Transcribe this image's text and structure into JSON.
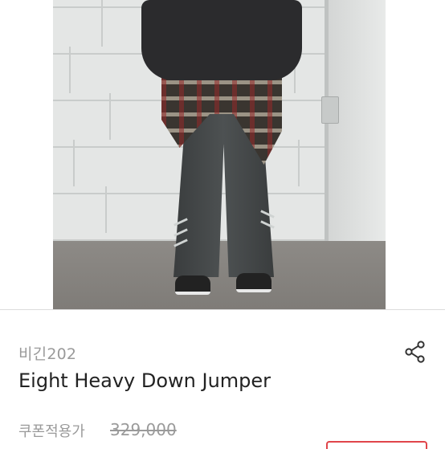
{
  "product": {
    "seller": "비긴202",
    "title": "Eight Heavy Down Jumper",
    "price_label": "쿠폰적용가",
    "price_original": "329,000"
  },
  "icons": {
    "share": "share-icon"
  },
  "colors": {
    "title": "#222222",
    "muted": "#9a9a9a",
    "accent": "#e0454a"
  }
}
